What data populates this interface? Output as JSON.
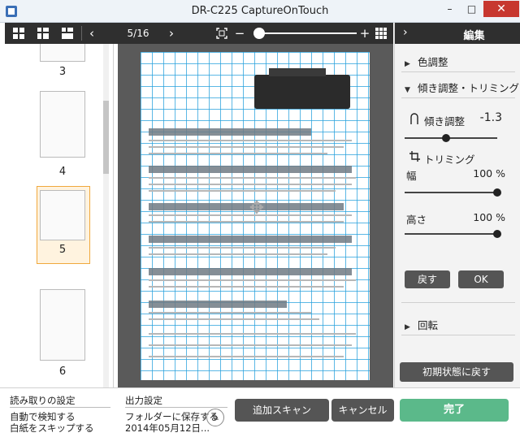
{
  "window": {
    "title": "DR-C225 CaptureOnTouch",
    "minimize": "–",
    "maximize": "□",
    "close": "✕"
  },
  "toolbar": {
    "prev": "‹",
    "next": "›",
    "page_indicator": "5/16",
    "zoom_minus": "−",
    "zoom_plus": "+",
    "zoom_level": 0.05
  },
  "thumbnails": [
    {
      "label": "3",
      "selected": false
    },
    {
      "label": "4",
      "selected": false
    },
    {
      "label": "5",
      "selected": true
    },
    {
      "label": "6",
      "selected": false
    }
  ],
  "right_panel": {
    "header_chevron": "›",
    "title": "編集",
    "color_adjust": "色調整",
    "deskew_trim": "傾き調整・トリミング",
    "deskew_label": "傾き調整",
    "deskew_value": "-1.3",
    "deskew_position": 0.45,
    "trim_label": "トリミング",
    "width_label": "幅",
    "width_value": "100 %",
    "width_percent": 100,
    "height_label": "高さ",
    "height_value": "100 %",
    "height_percent": 100,
    "undo_button": "戻す",
    "ok_button": "OK",
    "rotate": "回転",
    "reset_button": "初期状態に戻す"
  },
  "bottom": {
    "read_settings_title": "読み取りの設定",
    "read_settings_line1": "自動で検知する",
    "read_settings_line2": "白紙をスキップする",
    "output_title": "出力設定",
    "output_line1": "フォルダーに保存する",
    "output_line2": "2014年05月12日...",
    "edit_icon": "✎",
    "add_scan_button": "追加スキャン",
    "cancel_button": "キャンセル",
    "done_button": "完了"
  },
  "colors": {
    "accent": "#5bb98a",
    "selection": "#f0a83c",
    "grid": "#26a0dc",
    "toolbar": "#2f2f2f"
  }
}
